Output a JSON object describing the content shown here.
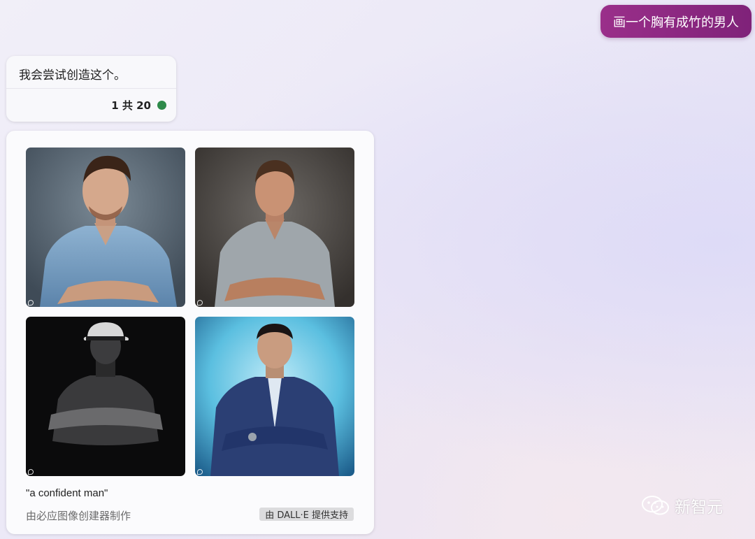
{
  "user_message": "画一个胸有成竹的男人",
  "reply": {
    "text": "我会尝试创造这个。",
    "counter": "1 共 20",
    "status_color": "#2e8a4a"
  },
  "image_card": {
    "images": [
      {
        "icon": "generated-portrait-1"
      },
      {
        "icon": "generated-portrait-2"
      },
      {
        "icon": "generated-portrait-3"
      },
      {
        "icon": "generated-portrait-4"
      }
    ],
    "prompt": "\"a confident man\"",
    "made_by": "由必应图像创建器制作",
    "powered_by": "由 DALL·E 提供支持"
  },
  "watermark": "新智元",
  "colors": {
    "user_bubble": "#8f2a85",
    "accent_green": "#2e8a4a"
  }
}
